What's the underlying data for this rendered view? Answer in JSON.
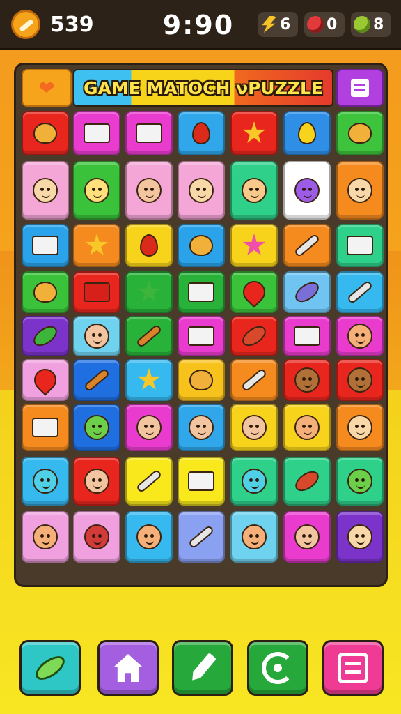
{
  "header": {
    "coins": "539",
    "timer": "9:90",
    "stats": [
      {
        "icon": "lightning-icon",
        "value": "6"
      },
      {
        "icon": "red-gem-icon",
        "value": "0"
      },
      {
        "icon": "green-blob-icon",
        "value": "8"
      }
    ]
  },
  "board": {
    "title": "GAME MATOCH νPUZZLE",
    "rows": [
      [
        {
          "icon": "bird-icon",
          "bg": "#e8261e"
        },
        {
          "icon": "document-icon",
          "bg": "#e93ccf"
        },
        {
          "icon": "monitor-icon",
          "bg": "#e93ccf"
        },
        {
          "icon": "balloon-icon",
          "bg": "#2fa7ea"
        },
        {
          "icon": "star-icon",
          "bg": "#e8261e"
        },
        {
          "icon": "lemon-icon",
          "bg": "#2f8fe6"
        },
        {
          "icon": "gear-icon",
          "bg": "#3dc43c"
        }
      ],
      [
        {
          "icon": "character-icon",
          "bg": "#f4a7d7"
        },
        {
          "icon": "sun-face-icon",
          "bg": "#3ac23a"
        },
        {
          "icon": "fox-icon",
          "bg": "#f4a7d7"
        },
        {
          "icon": "girl-icon",
          "bg": "#f4a7d7"
        },
        {
          "icon": "clown-icon",
          "bg": "#2fd08a"
        },
        {
          "icon": "purple-monster-icon",
          "bg": "#ffffff"
        },
        {
          "icon": "chef-icon",
          "bg": "#f58a1e"
        }
      ],
      [
        {
          "icon": "picture-icon",
          "bg": "#2aa3ea"
        },
        {
          "icon": "star-icon",
          "bg": "#f58a1e"
        },
        {
          "icon": "apple-icon",
          "bg": "#f8d31c"
        },
        {
          "icon": "flame-icon",
          "bg": "#2aa3ea"
        },
        {
          "icon": "pink-star-icon",
          "bg": "#f8d31c"
        },
        {
          "icon": "capsule-icon",
          "bg": "#f58a1e"
        },
        {
          "icon": "flag-icon",
          "bg": "#2fd08a"
        }
      ],
      [
        {
          "icon": "bottle-icon",
          "bg": "#3ac23a"
        },
        {
          "icon": "briefcase-icon",
          "bg": "#e8261e"
        },
        {
          "icon": "green-star-icon",
          "bg": "#28b23a"
        },
        {
          "icon": "computer-icon",
          "bg": "#28b23a"
        },
        {
          "icon": "heart-icon",
          "bg": "#3ac23a"
        },
        {
          "icon": "leaf-icon",
          "bg": "#6fc4f2"
        },
        {
          "icon": "brush-icon",
          "bg": "#36b9ef"
        }
      ],
      [
        {
          "icon": "plant-icon",
          "bg": "#7b33c9"
        },
        {
          "icon": "boy-icon",
          "bg": "#6fd2ef"
        },
        {
          "icon": "banana-icon",
          "bg": "#28b23a"
        },
        {
          "icon": "blocks-icon",
          "bg": "#e93ccf"
        },
        {
          "icon": "football-icon",
          "bg": "#e8261e"
        },
        {
          "icon": "phone-icon",
          "bg": "#e93ccf"
        },
        {
          "icon": "smiley-icon",
          "bg": "#e93ccf"
        }
      ],
      [
        {
          "icon": "peach-icon",
          "bg": "#f0a0de"
        },
        {
          "icon": "log-icon",
          "bg": "#1f6fe0"
        },
        {
          "icon": "starfish-icon",
          "bg": "#36b9ef"
        },
        {
          "icon": "puzzle-piece-icon",
          "bg": "#f8c21c"
        },
        {
          "icon": "scroll-icon",
          "bg": "#f58a1e"
        },
        {
          "icon": "bear-icon",
          "bg": "#e8261e"
        },
        {
          "icon": "monkey-icon",
          "bg": "#e8261e"
        }
      ],
      [
        {
          "icon": "microphone-icon",
          "bg": "#f58a1e"
        },
        {
          "icon": "frog-face-icon",
          "bg": "#1f6fe0"
        },
        {
          "icon": "cat-icon",
          "bg": "#e93ccf"
        },
        {
          "icon": "kid-icon",
          "bg": "#2fa7ea"
        },
        {
          "icon": "pig-icon",
          "bg": "#f8d31c"
        },
        {
          "icon": "blonde-face-icon",
          "bg": "#f8d31c"
        },
        {
          "icon": "bell-face-icon",
          "bg": "#f58a1e"
        }
      ],
      [
        {
          "icon": "alien-icon",
          "bg": "#36b9ef"
        },
        {
          "icon": "man-face-icon",
          "bg": "#e8261e"
        },
        {
          "icon": "pen-icon",
          "bg": "#f8e81c"
        },
        {
          "icon": "radio-icon",
          "bg": "#f8e81c"
        },
        {
          "icon": "cyan-alien-icon",
          "bg": "#2fd08a"
        },
        {
          "icon": "red-leaf-icon",
          "bg": "#2fd08a"
        },
        {
          "icon": "green-face-icon",
          "bg": "#2fd08a"
        }
      ],
      [
        {
          "icon": "orange-face-icon",
          "bg": "#f0a0de"
        },
        {
          "icon": "devil-icon",
          "bg": "#f0a0de"
        },
        {
          "icon": "helmet-face-icon",
          "bg": "#36b9ef"
        },
        {
          "icon": "wand-icon",
          "bg": "#8aa0f0"
        },
        {
          "icon": "person-face-icon",
          "bg": "#6fd2ef"
        },
        {
          "icon": "fox-girl-icon",
          "bg": "#e93ccf"
        },
        {
          "icon": "lion-icon",
          "bg": "#7b33c9"
        }
      ]
    ]
  },
  "toolbar": [
    {
      "name": "leaf-button",
      "icon": "leaf-icon",
      "bg": "#2fc6c6"
    },
    {
      "name": "home-button",
      "icon": "home-icon",
      "bg": "#a45ee0"
    },
    {
      "name": "pen-button",
      "icon": "pen-icon",
      "bg": "#27a83a"
    },
    {
      "name": "refresh-button",
      "icon": "refresh-icon",
      "bg": "#27a83a"
    },
    {
      "name": "menu-button",
      "icon": "list-icon",
      "bg": "#ef3b93"
    }
  ],
  "colors": {
    "topbar": "#2d2218",
    "board": "#4a3a2a"
  }
}
